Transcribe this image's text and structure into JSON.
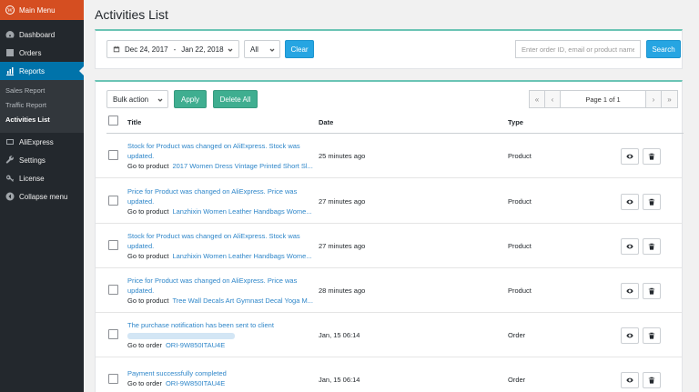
{
  "sidebar": {
    "main_menu": "Main Menu",
    "items": [
      {
        "label": "Dashboard",
        "icon": "dashboard-icon"
      },
      {
        "label": "Orders",
        "icon": "orders-icon"
      },
      {
        "label": "Reports",
        "icon": "reports-icon"
      }
    ],
    "submenu": [
      "Sales Report",
      "Traffic Report",
      "Activities List"
    ],
    "lower_items": [
      {
        "label": "AliExpress",
        "icon": "aliexpress-icon"
      },
      {
        "label": "Settings",
        "icon": "wrench-icon"
      },
      {
        "label": "License",
        "icon": "key-icon"
      },
      {
        "label": "Collapse menu",
        "icon": "collapse-icon"
      }
    ]
  },
  "page": {
    "title": "Activities List"
  },
  "filters": {
    "date_from": "Dec 24, 2017",
    "date_sep": "-",
    "date_to": "Jan 22, 2018",
    "status_selected": "All",
    "clear_label": "Clear",
    "search_placeholder": "Enter order ID, email or product name",
    "search_label": "Search"
  },
  "toolbar": {
    "bulk_action": "Bulk action",
    "apply_label": "Apply",
    "delete_all_label": "Delete All",
    "pager": {
      "first": "«",
      "prev": "‹",
      "info": "Page 1 of 1",
      "next": "›",
      "last": "»"
    }
  },
  "table": {
    "columns": {
      "title": "Title",
      "date": "Date",
      "type": "Type"
    },
    "rows": [
      {
        "line1": "Stock for Product was changed on AliExpress. Stock was",
        "line2": "updated.",
        "goto": "Go to product",
        "target": "2017 Women Dress Vintage Printed Short Sl...",
        "date": "25 minutes ago",
        "type": "Product"
      },
      {
        "line1": "Price for Product was changed on AliExpress. Price was",
        "line2": "updated.",
        "goto": "Go to product",
        "target": "Lanzhixin Women Leather Handbags Wome...",
        "date": "27 minutes ago",
        "type": "Product"
      },
      {
        "line1": "Stock for Product was changed on AliExpress. Stock was",
        "line2": "updated.",
        "goto": "Go to product",
        "target": "Lanzhixin Women Leather Handbags Wome...",
        "date": "27 minutes ago",
        "type": "Product"
      },
      {
        "line1": "Price for Product was changed on AliExpress. Price was",
        "line2": "updated.",
        "goto": "Go to product",
        "target": "Tree Wall Decals Art Gymnast Decal Yoga M...",
        "date": "28 minutes ago",
        "type": "Product"
      },
      {
        "line1": "The purchase notification has been sent to client",
        "line2": "",
        "goto": "Go to order",
        "target": "ORI-9W850ITAU4E",
        "date": "Jan, 15 06:14",
        "type": "Order"
      },
      {
        "line1": "Payment successfully completed",
        "line2": "",
        "goto": "Go to order",
        "target": "ORI-9W850ITAU4E",
        "date": "Jan, 15 06:14",
        "type": "Order"
      }
    ]
  },
  "colors": {
    "sidebar_bg": "#23282d",
    "active_blue": "#0073aa",
    "main_menu_orange": "#d54e21",
    "accent_teal": "#6bc4b5",
    "button_blue": "#26a5e2",
    "button_green": "#3fae90",
    "link": "#2e86c9"
  }
}
